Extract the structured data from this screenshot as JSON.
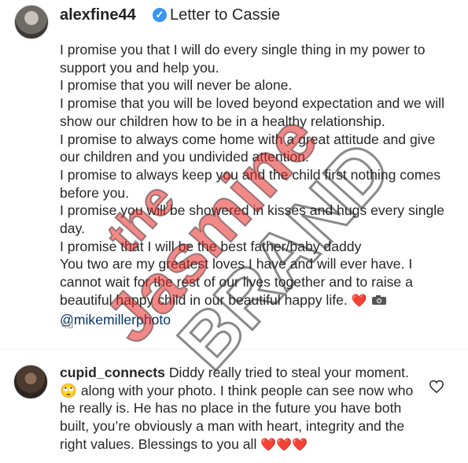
{
  "post": {
    "username": "alexfine44",
    "title": "Letter to Cassie",
    "caption_lines": [
      "I promise you that I will do every single thing in my power to support you and help you.",
      "I promise that you will never be alone.",
      "I promise that you will be loved beyond expectation and we will show our children how to be in a healthy relationship.",
      "I promise to always come home with a great attitude and give our children and you undivided attention.",
      "I promise to always keep you and the child first nothing comes before you.",
      "I promise you will be showered in kisses and hugs every single day.",
      "I promise that I will be the best father/baby daddy",
      "You two are my greatest loves I have and will ever have. I cannot wait for the rest of our lives together and to raise a beautiful happy child in our beautiful happy life."
    ],
    "caption_emoji": "❤️",
    "mention": "@mikemillerphoto",
    "age": "4d"
  },
  "comment": {
    "username": "cupid_connects",
    "text_before_emoji": "Diddy really tried to steal your moment.",
    "emoji": "🙄",
    "text_after_emoji": "along with your photo. I think people can see now who he really is. He has no place in the future you have both built, you’re obviously a man with heart, integrity and the right values. Blessings to you all",
    "hearts": "❤️❤️❤️"
  },
  "watermark": {
    "line1": "the",
    "line2": "Jasmine",
    "line3": "BRAND"
  },
  "icons": {
    "verified": "verified-badge-icon",
    "camera": "camera-icon",
    "like": "heart-outline-icon"
  },
  "colors": {
    "heart": "#ed4956",
    "verified": "#3897f0",
    "watermark_red": "#e02020"
  }
}
